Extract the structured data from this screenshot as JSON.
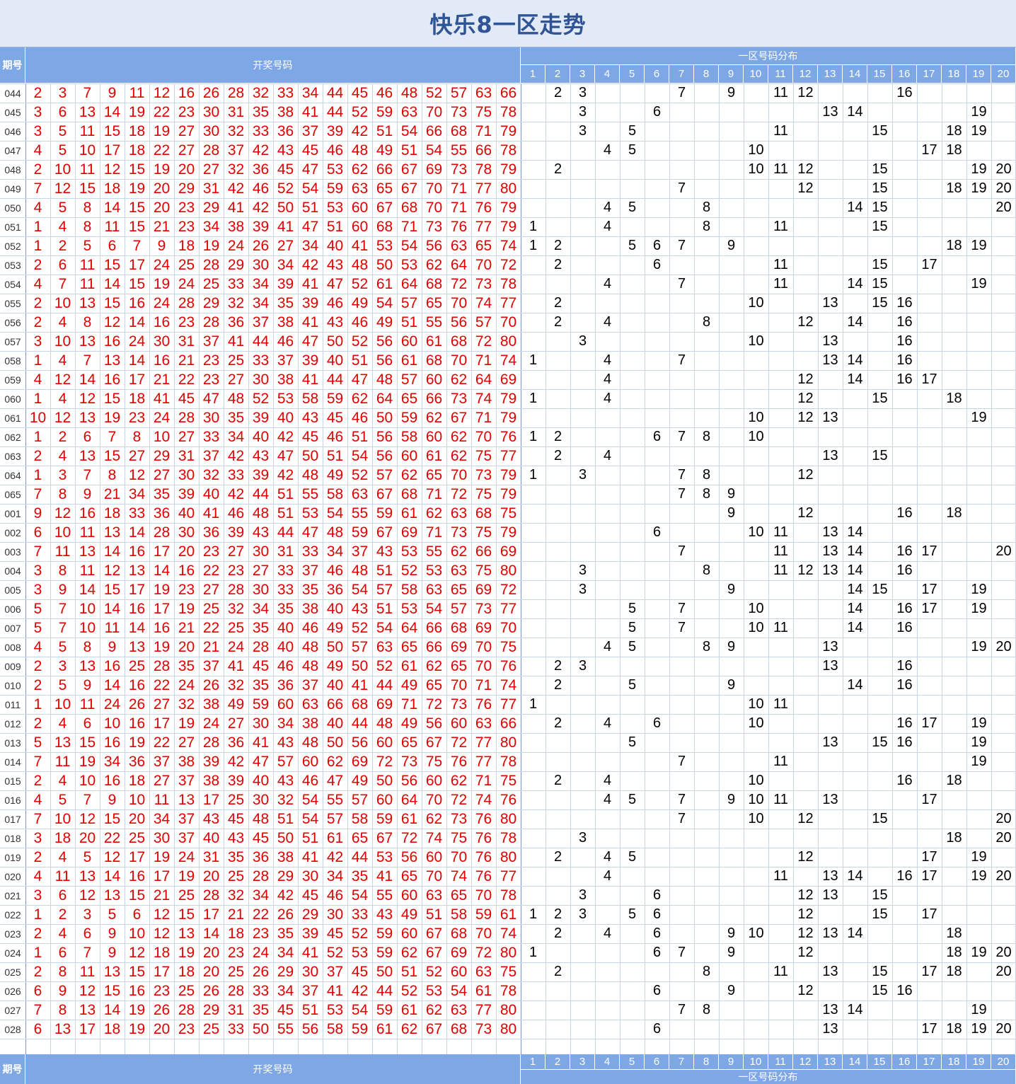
{
  "title": "快乐8一区走势",
  "header": {
    "period_label": "期号",
    "draw_label": "开奖号码",
    "zone_label": "一区号码分布",
    "zone_numbers": [
      "1",
      "2",
      "3",
      "4",
      "5",
      "6",
      "7",
      "8",
      "9",
      "10",
      "11",
      "12",
      "13",
      "14",
      "15",
      "16",
      "17",
      "18",
      "19",
      "20"
    ]
  },
  "colors": {
    "header_bg": "#7ea7e6",
    "title_bg": "#e3eaf7",
    "title_text": "#2f5597",
    "draw_number": "#e00000",
    "zone_number": "#000000",
    "grid_line": "#c9d4e6"
  },
  "chart_data": {
    "type": "table",
    "title": "快乐8一区走势",
    "columns": [
      "期号",
      "开奖号码",
      "一区号码分布"
    ],
    "rows": [
      {
        "period": "044",
        "numbers": [
          2,
          3,
          7,
          9,
          11,
          12,
          16,
          26,
          28,
          32,
          33,
          34,
          44,
          45,
          46,
          48,
          52,
          57,
          63,
          66
        ]
      },
      {
        "period": "045",
        "numbers": [
          3,
          6,
          13,
          14,
          19,
          22,
          23,
          30,
          31,
          35,
          38,
          41,
          44,
          52,
          59,
          63,
          70,
          73,
          75,
          78
        ]
      },
      {
        "period": "046",
        "numbers": [
          3,
          5,
          11,
          15,
          18,
          19,
          27,
          30,
          32,
          33,
          36,
          37,
          39,
          42,
          51,
          54,
          66,
          68,
          71,
          79
        ]
      },
      {
        "period": "047",
        "numbers": [
          4,
          5,
          10,
          17,
          18,
          22,
          27,
          28,
          37,
          42,
          43,
          45,
          46,
          48,
          49,
          51,
          54,
          55,
          66,
          78
        ]
      },
      {
        "period": "048",
        "numbers": [
          2,
          10,
          11,
          12,
          15,
          19,
          20,
          27,
          32,
          36,
          45,
          47,
          53,
          62,
          66,
          67,
          69,
          73,
          78,
          79
        ]
      },
      {
        "period": "049",
        "numbers": [
          7,
          12,
          15,
          18,
          19,
          20,
          29,
          31,
          42,
          46,
          52,
          54,
          59,
          63,
          65,
          67,
          70,
          71,
          77,
          80
        ]
      },
      {
        "period": "050",
        "numbers": [
          4,
          5,
          8,
          14,
          15,
          20,
          23,
          29,
          41,
          42,
          50,
          51,
          53,
          60,
          67,
          68,
          70,
          71,
          76,
          79
        ]
      },
      {
        "period": "051",
        "numbers": [
          1,
          4,
          8,
          11,
          15,
          21,
          23,
          34,
          38,
          39,
          41,
          47,
          51,
          60,
          68,
          71,
          73,
          76,
          77,
          79
        ]
      },
      {
        "period": "052",
        "numbers": [
          1,
          2,
          5,
          6,
          7,
          9,
          18,
          19,
          24,
          26,
          27,
          34,
          40,
          41,
          53,
          54,
          56,
          63,
          65,
          74
        ]
      },
      {
        "period": "053",
        "numbers": [
          2,
          6,
          11,
          15,
          17,
          24,
          25,
          28,
          29,
          30,
          34,
          42,
          43,
          48,
          50,
          53,
          62,
          64,
          70,
          72
        ]
      },
      {
        "period": "054",
        "numbers": [
          4,
          7,
          11,
          14,
          15,
          19,
          24,
          25,
          33,
          34,
          39,
          41,
          47,
          52,
          61,
          64,
          68,
          72,
          73,
          78
        ]
      },
      {
        "period": "055",
        "numbers": [
          2,
          10,
          13,
          15,
          16,
          24,
          28,
          29,
          32,
          34,
          35,
          39,
          46,
          49,
          54,
          57,
          65,
          70,
          74,
          77
        ]
      },
      {
        "period": "056",
        "numbers": [
          2,
          4,
          8,
          12,
          14,
          16,
          23,
          28,
          36,
          37,
          38,
          41,
          43,
          46,
          49,
          51,
          55,
          56,
          57,
          70
        ]
      },
      {
        "period": "057",
        "numbers": [
          3,
          10,
          13,
          16,
          24,
          30,
          31,
          37,
          41,
          44,
          46,
          47,
          50,
          52,
          56,
          60,
          61,
          68,
          72,
          80
        ]
      },
      {
        "period": "058",
        "numbers": [
          1,
          4,
          7,
          13,
          14,
          16,
          21,
          23,
          25,
          33,
          37,
          39,
          40,
          51,
          56,
          61,
          68,
          70,
          71,
          74
        ]
      },
      {
        "period": "059",
        "numbers": [
          4,
          12,
          14,
          16,
          17,
          21,
          22,
          23,
          27,
          30,
          38,
          41,
          44,
          47,
          48,
          57,
          60,
          62,
          64,
          69
        ]
      },
      {
        "period": "060",
        "numbers": [
          1,
          4,
          12,
          15,
          18,
          41,
          45,
          47,
          48,
          52,
          53,
          58,
          59,
          62,
          64,
          65,
          66,
          73,
          74,
          79
        ]
      },
      {
        "period": "061",
        "numbers": [
          10,
          12,
          13,
          19,
          23,
          24,
          28,
          30,
          35,
          39,
          40,
          43,
          45,
          46,
          50,
          59,
          62,
          67,
          71,
          79
        ]
      },
      {
        "period": "062",
        "numbers": [
          1,
          2,
          6,
          7,
          8,
          10,
          27,
          33,
          34,
          40,
          42,
          45,
          46,
          51,
          56,
          58,
          60,
          62,
          70,
          76
        ]
      },
      {
        "period": "063",
        "numbers": [
          2,
          4,
          13,
          15,
          27,
          29,
          31,
          37,
          42,
          43,
          47,
          50,
          51,
          54,
          56,
          60,
          61,
          62,
          75,
          77
        ]
      },
      {
        "period": "064",
        "numbers": [
          1,
          3,
          7,
          8,
          12,
          27,
          30,
          32,
          33,
          39,
          42,
          48,
          49,
          52,
          57,
          62,
          65,
          70,
          73,
          79
        ]
      },
      {
        "period": "065",
        "numbers": [
          7,
          8,
          9,
          21,
          34,
          35,
          39,
          40,
          42,
          44,
          51,
          55,
          58,
          63,
          67,
          68,
          71,
          72,
          75,
          79
        ]
      },
      {
        "period": "001",
        "numbers": [
          9,
          12,
          16,
          18,
          33,
          36,
          40,
          41,
          46,
          48,
          51,
          53,
          54,
          55,
          59,
          61,
          62,
          63,
          68,
          75
        ]
      },
      {
        "period": "002",
        "numbers": [
          6,
          10,
          11,
          13,
          14,
          28,
          30,
          36,
          39,
          43,
          44,
          47,
          48,
          59,
          67,
          69,
          71,
          73,
          75,
          79
        ]
      },
      {
        "period": "003",
        "numbers": [
          7,
          11,
          13,
          14,
          16,
          17,
          20,
          23,
          27,
          30,
          31,
          33,
          34,
          37,
          43,
          53,
          55,
          62,
          66,
          69
        ]
      },
      {
        "period": "004",
        "numbers": [
          3,
          8,
          11,
          12,
          13,
          14,
          16,
          22,
          23,
          27,
          33,
          37,
          46,
          48,
          51,
          52,
          53,
          63,
          75,
          80
        ]
      },
      {
        "period": "005",
        "numbers": [
          3,
          9,
          14,
          15,
          17,
          19,
          23,
          27,
          28,
          30,
          33,
          35,
          36,
          54,
          57,
          58,
          63,
          65,
          69,
          72
        ]
      },
      {
        "period": "006",
        "numbers": [
          5,
          7,
          10,
          14,
          16,
          17,
          19,
          25,
          32,
          34,
          35,
          38,
          40,
          43,
          51,
          53,
          54,
          57,
          73,
          77
        ]
      },
      {
        "period": "007",
        "numbers": [
          5,
          7,
          10,
          11,
          14,
          16,
          21,
          22,
          25,
          35,
          40,
          46,
          49,
          52,
          54,
          64,
          66,
          68,
          69,
          70
        ]
      },
      {
        "period": "008",
        "numbers": [
          4,
          5,
          8,
          9,
          13,
          19,
          20,
          21,
          24,
          28,
          40,
          48,
          50,
          57,
          63,
          65,
          66,
          69,
          70,
          75
        ]
      },
      {
        "period": "009",
        "numbers": [
          2,
          3,
          13,
          16,
          25,
          28,
          35,
          37,
          41,
          45,
          46,
          48,
          49,
          50,
          52,
          61,
          62,
          65,
          70,
          76
        ]
      },
      {
        "period": "010",
        "numbers": [
          2,
          5,
          9,
          14,
          16,
          22,
          24,
          26,
          32,
          35,
          36,
          37,
          40,
          41,
          44,
          49,
          65,
          70,
          71,
          74
        ]
      },
      {
        "period": "011",
        "numbers": [
          1,
          10,
          11,
          24,
          26,
          27,
          32,
          38,
          49,
          59,
          60,
          63,
          66,
          68,
          69,
          71,
          72,
          73,
          76,
          77
        ]
      },
      {
        "period": "012",
        "numbers": [
          2,
          4,
          6,
          10,
          16,
          17,
          19,
          24,
          27,
          30,
          34,
          38,
          40,
          44,
          48,
          49,
          56,
          60,
          63,
          66
        ]
      },
      {
        "period": "013",
        "numbers": [
          5,
          13,
          15,
          16,
          19,
          22,
          27,
          28,
          36,
          41,
          43,
          48,
          50,
          56,
          60,
          65,
          67,
          72,
          77,
          80
        ]
      },
      {
        "period": "014",
        "numbers": [
          7,
          11,
          19,
          34,
          36,
          37,
          38,
          39,
          42,
          47,
          57,
          60,
          62,
          69,
          72,
          73,
          75,
          76,
          77,
          78
        ]
      },
      {
        "period": "015",
        "numbers": [
          2,
          4,
          10,
          16,
          18,
          27,
          37,
          38,
          39,
          40,
          43,
          46,
          47,
          49,
          50,
          56,
          60,
          62,
          71,
          75
        ]
      },
      {
        "period": "016",
        "numbers": [
          4,
          5,
          7,
          9,
          10,
          11,
          13,
          17,
          25,
          30,
          32,
          54,
          55,
          57,
          60,
          64,
          70,
          72,
          74,
          76
        ]
      },
      {
        "period": "017",
        "numbers": [
          7,
          10,
          12,
          15,
          20,
          34,
          37,
          43,
          45,
          48,
          51,
          54,
          57,
          58,
          59,
          61,
          62,
          73,
          76,
          80
        ]
      },
      {
        "period": "018",
        "numbers": [
          3,
          18,
          20,
          22,
          25,
          30,
          37,
          40,
          43,
          45,
          50,
          51,
          61,
          65,
          67,
          72,
          74,
          75,
          76,
          78
        ]
      },
      {
        "period": "019",
        "numbers": [
          2,
          4,
          5,
          12,
          17,
          19,
          24,
          31,
          35,
          36,
          38,
          41,
          42,
          44,
          53,
          56,
          60,
          70,
          76,
          80
        ]
      },
      {
        "period": "020",
        "numbers": [
          4,
          11,
          13,
          14,
          16,
          17,
          19,
          20,
          25,
          28,
          29,
          30,
          34,
          35,
          41,
          65,
          70,
          74,
          76,
          77
        ]
      },
      {
        "period": "021",
        "numbers": [
          3,
          6,
          12,
          13,
          15,
          21,
          25,
          28,
          32,
          34,
          42,
          45,
          46,
          54,
          55,
          60,
          63,
          65,
          70,
          78
        ]
      },
      {
        "period": "022",
        "numbers": [
          1,
          2,
          3,
          5,
          6,
          12,
          15,
          17,
          21,
          22,
          26,
          29,
          30,
          33,
          43,
          49,
          51,
          58,
          59,
          61
        ]
      },
      {
        "period": "023",
        "numbers": [
          2,
          4,
          6,
          9,
          10,
          12,
          13,
          14,
          18,
          23,
          35,
          39,
          45,
          52,
          59,
          60,
          67,
          68,
          70,
          74
        ]
      },
      {
        "period": "024",
        "numbers": [
          1,
          6,
          7,
          9,
          12,
          18,
          19,
          20,
          23,
          24,
          34,
          41,
          52,
          53,
          59,
          62,
          67,
          69,
          72,
          80
        ]
      },
      {
        "period": "025",
        "numbers": [
          2,
          8,
          11,
          13,
          15,
          17,
          18,
          20,
          25,
          26,
          29,
          30,
          37,
          45,
          50,
          51,
          52,
          60,
          63,
          75
        ]
      },
      {
        "period": "026",
        "numbers": [
          6,
          9,
          12,
          15,
          16,
          23,
          25,
          26,
          28,
          33,
          34,
          37,
          41,
          42,
          44,
          52,
          53,
          54,
          61,
          78
        ]
      },
      {
        "period": "027",
        "numbers": [
          7,
          8,
          13,
          14,
          19,
          26,
          28,
          29,
          31,
          35,
          45,
          51,
          53,
          54,
          59,
          61,
          62,
          63,
          77,
          80
        ]
      },
      {
        "period": "028",
        "numbers": [
          6,
          13,
          17,
          18,
          19,
          20,
          23,
          25,
          33,
          50,
          55,
          56,
          58,
          59,
          61,
          62,
          67,
          68,
          73,
          80
        ]
      }
    ]
  }
}
